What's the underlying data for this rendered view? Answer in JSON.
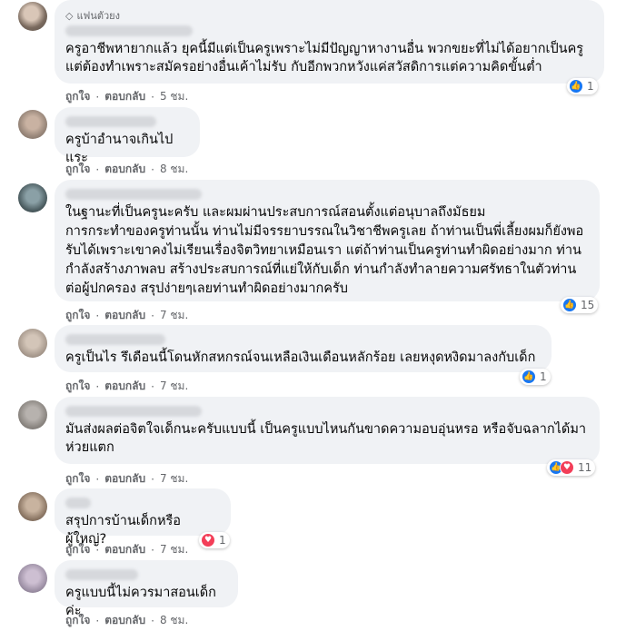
{
  "labels": {
    "like": "ถูกใจ",
    "reply": "ตอบกลับ",
    "separator": "·"
  },
  "comments": [
    {
      "badge": "แฟนตัวยง",
      "text": "ครูอาชีพหายากแล้ว ยุคนี้มีแต่เป็นครูเพราะไม่มีปัญญาหางานอื่น พวกขยะที่ไม่ได้อยากเป็นครู\nแต่ต้องทำเพราะสมัครอย่างอื่นเค้าไม่รับ กับอีกพวกหวังแค่สวัสดิการแต่ความคิดขั้นต่ำ",
      "time": "5 ชม.",
      "reaction_count": "1",
      "reactions": [
        "like-icon"
      ]
    },
    {
      "text": "ครูบ้าอำนาจเกินไปแระ",
      "time": "8 ชม.",
      "reaction_count": "",
      "reactions": []
    },
    {
      "text": "ในฐานะที่เป็นครูนะครับ และผมผ่านประสบการณ์สอนตั้งแต่อนุบาลถึงมัธยม\nการกระทำของครูท่านนั้น ท่านไม่มีจรรยาบรรณในวิชาชีพครูเลย ถ้าท่านเป็นพี่เลี้ยงผมก็ยังพอ\nรับได้เพราะเขาคงไม่เรียนเรื่องจิตวิทยาเหมือนเรา แต่ถ้าท่านเป็นครูท่านทำผิดอย่างมาก ท่าน\nกำลังสร้างภาพลบ สร้างประสบการณ์ที่แย่ให้กับเด็ก ท่านกำลังทำลายความศรัทธาในตัวท่าน\nต่อผู้ปกครอง สรุปง่ายๆเลยท่านทำผิดอย่างมากครับ",
      "time": "7 ชม.",
      "reaction_count": "15",
      "reactions": [
        "like-icon"
      ]
    },
    {
      "text": "ครูเป็นไร รึเดือนนี้โดนหักสหกรณ์จนเหลือเงินเดือนหลักร้อย เลยหงุดหงิดมาลงกับเด็ก",
      "time": "7 ชม.",
      "reaction_count": "1",
      "reactions": [
        "like-icon"
      ]
    },
    {
      "text": "มันส่งผลต่อจิตใจเด็กนะครับแบบนี้ เป็นครูแบบไหนกันขาดความอบอุ่นหรอ หรือจับฉลากได้มา\nห่วยแตก",
      "time": "7 ชม.",
      "reaction_count": "11",
      "reactions": [
        "like-icon",
        "love-icon"
      ]
    },
    {
      "text": "สรุปการบ้านเด็กหรือผู้ใหญ่?",
      "time": "7 ชม.",
      "reaction_count": "1",
      "reactions": [
        "love-icon"
      ]
    },
    {
      "text": "ครูแบบนี้ไม่ควรมาสอนเด็กค่ะ",
      "time": "8 ชม.",
      "reaction_count": "",
      "reactions": []
    }
  ],
  "colors": {
    "bubble": "#f0f2f5",
    "like": "#1877f2",
    "love": "#f33e58",
    "meta": "#65676b"
  }
}
